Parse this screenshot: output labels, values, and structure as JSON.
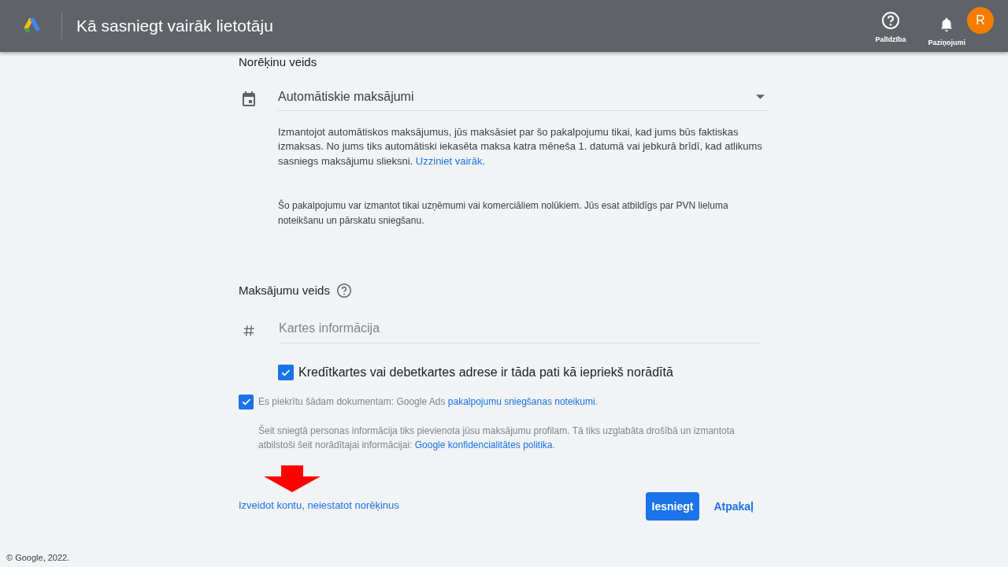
{
  "header": {
    "title": "Kā sasniegt vairāk lietotāju",
    "help_label": "Palīdzība",
    "notifications_label": "Paziņojumi",
    "avatar_letter": "R"
  },
  "billing": {
    "heading": "Norēķinu veids",
    "dropdown_value": "Automātiskie maksājumi",
    "description": "Izmantojot automātiskos maksājumus, jūs maksāsiet par šo pakalpojumu tikai, kad jums būs faktiskas izmaksas. No jums tiks automātiski iekasēta maksa katra mēneša 1. datumā vai jebkurā brīdī, kad atlikums sasniegs maksājumu slieksni.",
    "learn_more": "Uzziniet vairāk.",
    "note": "Šo pakalpojumu var izmantot tikai uzņēmumi vai komerciāliem nolūkiem. Jūs esat atbildīgs par PVN lieluma noteikšanu un pārskatu sniegšanu."
  },
  "payment": {
    "heading": "Maksājumu veids",
    "card_placeholder": "Kartes informācija",
    "same_address": {
      "label": "Kredītkartes vai debetkartes adrese ir tāda pati kā iepriekš norādītā",
      "checked": true
    }
  },
  "terms": {
    "checked": true,
    "text": "Es piekrītu šādam dokumentam: Google Ads ",
    "link": "pakalpojumu sniegšanas noteikumi",
    "after": "."
  },
  "privacy": {
    "text": "Šeit sniegtā personas informācija tiks pievienota jūsu maksājumu profilam. Tā tiks uzglabāta drošībā un izmantota atbilstoši šeit norādītajai informācijai: ",
    "link": "Google konfidencialitātes politika",
    "after": "."
  },
  "actions": {
    "skip_link": "Izveidot kontu, neiestatot norēķinus",
    "submit": "Iesniegt",
    "back": "Atpakaļ"
  },
  "footer": "© Google, 2022."
}
